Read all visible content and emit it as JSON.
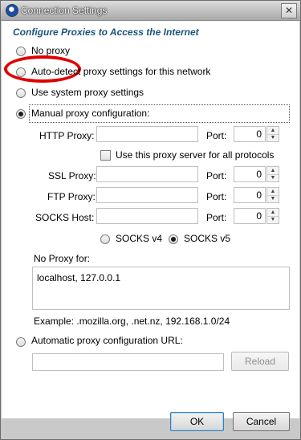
{
  "window": {
    "title": "Connection Settings",
    "close_symbol": "✕"
  },
  "section": {
    "heading": "Configure Proxies to Access the Internet"
  },
  "options": {
    "no_proxy": "No proxy",
    "auto_detect": "Auto-detect proxy settings for this network",
    "system": "Use system proxy settings",
    "manual": "Manual proxy configuration:",
    "automatic_url": "Automatic proxy configuration URL:"
  },
  "manual": {
    "http_label": "HTTP Proxy:",
    "ssl_label": "SSL Proxy:",
    "ftp_label": "FTP Proxy:",
    "socks_label": "SOCKS Host:",
    "port_label": "Port:",
    "use_same_proxy_label": "Use this proxy server for all protocols",
    "socks_v4_label": "SOCKS v4",
    "socks_v5_label": "SOCKS v5",
    "ports": [
      "0",
      "0",
      "0",
      "0"
    ],
    "http_value": "",
    "ssl_value": "",
    "ftp_value": "",
    "socks_value": ""
  },
  "no_proxy": {
    "label": "No Proxy for:",
    "value": "localhost, 127.0.0.1",
    "example": "Example: .mozilla.org, .net.nz, 192.168.1.0/24"
  },
  "auto_config": {
    "url_value": "",
    "reload_label": "Reload"
  },
  "buttons": {
    "ok": "OK",
    "cancel": "Cancel"
  },
  "state": {
    "selected_option": "manual",
    "use_same_proxy_checked": false,
    "socks_version": "v5"
  },
  "colors": {
    "heading": "#19557b",
    "highlight": "#e00000"
  },
  "icons": {
    "app": "firefox-icon",
    "close": "close-icon"
  }
}
